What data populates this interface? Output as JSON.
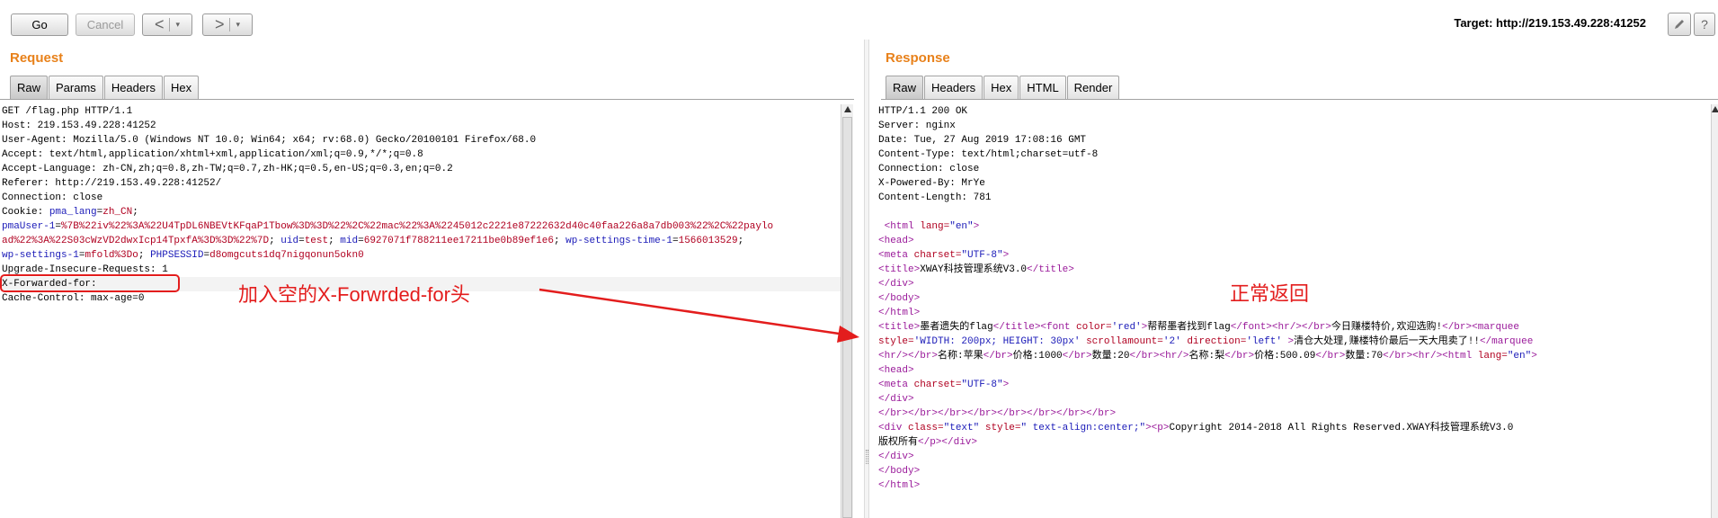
{
  "toolbar": {
    "go_label": "Go",
    "cancel_label": "Cancel",
    "back_glyph": "<",
    "forward_glyph": ">",
    "dropdown_glyph": "▾",
    "target_label": "Target: http://219.153.49.228:41252",
    "icons": [
      "edit-icon",
      "help-icon"
    ]
  },
  "request": {
    "title": "Request",
    "tabs": [
      "Raw",
      "Params",
      "Headers",
      "Hex"
    ],
    "active_tab": "Raw",
    "lines": [
      "GET /flag.php HTTP/1.1",
      "Host: 219.153.49.228:41252",
      "User-Agent: Mozilla/5.0 (Windows NT 10.0; Win64; x64; rv:68.0) Gecko/20100101 Firefox/68.0",
      "Accept: text/html,application/xhtml+xml,application/xml;q=0.9,*/*;q=0.8",
      "Accept-Language: zh-CN,zh;q=0.8,zh-TW;q=0.7,zh-HK;q=0.5,en-US;q=0.3,en;q=0.2",
      "Referer: http://219.153.49.228:41252/",
      "Connection: close"
    ],
    "cookie_prefix": "Cookie: ",
    "cookie_lines": [
      [
        {
          "k": "pma_lang",
          "v": "zh_CN"
        }
      ],
      [
        {
          "k": "pmaUser-1",
          "v": "%7B%22iv%22%3A%22U4TpDL6NBEVtKFqaP1Tbow%3D%3D%22%2C%22mac%22%3A%2245012c2221e87222632d40c40faa226a8a7db003%22%2C%22paylo"
        }
      ],
      [
        {
          "k": "",
          "v": "ad%22%3A%22S03cWzVD2dwxIcp14TpxfA%3D%3D%22%7D"
        },
        {
          "k": "uid",
          "v": "test"
        },
        {
          "k": "mid",
          "v": "6927071f788211ee17211be0b89ef1e6"
        },
        {
          "k": "wp-settings-time-1",
          "v": "1566013529"
        }
      ],
      [
        {
          "k": "wp-settings-1",
          "v": "mfold%3Do"
        },
        {
          "k": "PHPSESSID",
          "v": "d8omgcuts1dq7nigqonun5okn0"
        }
      ]
    ],
    "tail_lines": [
      "Upgrade-Insecure-Requests: 1",
      "X-Forwarded-for:",
      "Cache-Control: max-age=0"
    ]
  },
  "response": {
    "title": "Response",
    "tabs": [
      "Raw",
      "Headers",
      "Hex",
      "HTML",
      "Render"
    ],
    "active_tab": "Raw",
    "header_lines": [
      "HTTP/1.1 200 OK",
      "Server: nginx",
      "Date: Tue, 27 Aug 2019 17:08:16 GMT",
      "Content-Type: text/html;charset=utf-8",
      "Connection: close",
      "X-Powered-By: MrYe",
      "Content-Length: 781",
      ""
    ],
    "body_lines": [
      [
        [
          "t",
          " <html "
        ],
        [
          "a",
          "lang="
        ],
        [
          "v",
          "\"en\""
        ],
        [
          "t",
          ">"
        ]
      ],
      [
        [
          "t",
          "<head>"
        ]
      ],
      [
        [
          "t",
          "<meta "
        ],
        [
          "a",
          "charset="
        ],
        [
          "v",
          "\"UTF-8\""
        ],
        [
          "t",
          ">"
        ]
      ],
      [
        [
          "t",
          "<title>"
        ],
        [
          "x",
          "XWAY科技管理系统V3.0"
        ],
        [
          "t",
          "</title>"
        ]
      ],
      [
        [
          "t",
          "</div>"
        ]
      ],
      [
        [
          "t",
          "</body>"
        ]
      ],
      [
        [
          "t",
          "</html>"
        ]
      ],
      [
        [
          "t",
          "<title>"
        ],
        [
          "x",
          "墨者遗失的flag"
        ],
        [
          "t",
          "</title><font "
        ],
        [
          "a",
          "color="
        ],
        [
          "v",
          "'red'"
        ],
        [
          "t",
          ">"
        ],
        [
          "x",
          "帮帮墨者找到flag"
        ],
        [
          "t",
          "</font><hr/></br>"
        ],
        [
          "x",
          "今日赚楼特价,欢迎选购!"
        ],
        [
          "t",
          "</br><marquee"
        ]
      ],
      [
        [
          "a",
          "style="
        ],
        [
          "v",
          "'WIDTH: 200px; HEIGHT: 30px'"
        ],
        [
          "x",
          " "
        ],
        [
          "a",
          "scrollamount="
        ],
        [
          "v",
          "'2'"
        ],
        [
          "x",
          " "
        ],
        [
          "a",
          "direction="
        ],
        [
          "v",
          "'left'"
        ],
        [
          "t",
          " >"
        ],
        [
          "x",
          "清仓大处理,赚楼特价最后一天大甩卖了!!"
        ],
        [
          "t",
          "</marquee"
        ]
      ],
      [
        [
          "t",
          "<hr/></br>"
        ],
        [
          "x",
          "名称:苹果"
        ],
        [
          "t",
          "</br>"
        ],
        [
          "x",
          "价格:1000"
        ],
        [
          "t",
          "</br>"
        ],
        [
          "x",
          "数量:20"
        ],
        [
          "t",
          "</br><hr/>"
        ],
        [
          "x",
          "名称:梨"
        ],
        [
          "t",
          "</br>"
        ],
        [
          "x",
          "价格:500.09"
        ],
        [
          "t",
          "</br>"
        ],
        [
          "x",
          "数量:70"
        ],
        [
          "t",
          "</br><hr/><html "
        ],
        [
          "a",
          "lang="
        ],
        [
          "v",
          "\"en\""
        ],
        [
          "t",
          ">"
        ]
      ],
      [
        [
          "t",
          "<head>"
        ]
      ],
      [
        [
          "t",
          "<meta "
        ],
        [
          "a",
          "charset="
        ],
        [
          "v",
          "\"UTF-8\""
        ],
        [
          "t",
          ">"
        ]
      ],
      [
        [
          "t",
          "</div>"
        ]
      ],
      [
        [
          "t",
          "</br></br></br></br></br></br></br></br>"
        ]
      ],
      [
        [
          "t",
          "<div "
        ],
        [
          "a",
          "class="
        ],
        [
          "v",
          "\"text\""
        ],
        [
          "x",
          " "
        ],
        [
          "a",
          "style="
        ],
        [
          "v",
          "\" text-align:center;\""
        ],
        [
          "t",
          "><p>"
        ],
        [
          "x",
          "Copyright 2014-2018 All Rights Reserved.XWAY科技管理系统V3.0"
        ]
      ],
      [
        [
          "x",
          "版权所有"
        ],
        [
          "t",
          "</p></div>"
        ]
      ],
      [
        [
          "t",
          "</div>"
        ]
      ],
      [
        [
          "t",
          "</body>"
        ]
      ],
      [
        [
          "t",
          "</html>"
        ]
      ]
    ]
  },
  "annotations": {
    "left_note": "加入空的X-Forwrded-for头",
    "right_note": "正常返回",
    "color": "#e31d1d"
  },
  "colors": {
    "panel_title": "#e8811a",
    "header_name": "#1a1ab8",
    "header_value": "#b00020",
    "tag": "#9a1a9a"
  }
}
